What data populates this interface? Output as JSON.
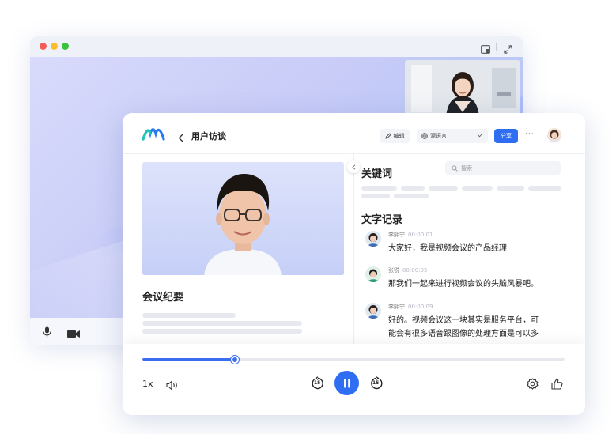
{
  "window": {
    "title": "用户访谈",
    "edit_label": "编辑",
    "language_label": "源语言",
    "share_label": "分享",
    "more_label": "···"
  },
  "left": {
    "minutes_title": "会议纪要"
  },
  "right": {
    "keywords_title": "关键词",
    "search_placeholder": "搜索",
    "transcript_title": "文字记录",
    "entries": [
      {
        "speaker": "李熙宁",
        "time": "00:00:01",
        "text_lines": [
          "大家好，我是视频会议的产品经理"
        ]
      },
      {
        "speaker": "张锐",
        "time": "00:00:05",
        "text_lines": [
          "那我们一起来进行视频会议的头脑风暴吧。"
        ]
      },
      {
        "speaker": "李熙宁",
        "time": "00:00:09",
        "text_lines": [
          "好的。视频会议这一块其实是服务平台，可",
          "能会有很多语音跟图像的处理方面是可以多"
        ]
      }
    ]
  },
  "player": {
    "speed_label": "1x",
    "progress_fraction": 0.22,
    "rewind_seconds": "15",
    "forward_seconds": "15"
  },
  "colors": {
    "accent": "#3a6df0",
    "traffic_red": "#f25f58",
    "traffic_yellow": "#fbbe2e",
    "traffic_green": "#3ac13e"
  }
}
